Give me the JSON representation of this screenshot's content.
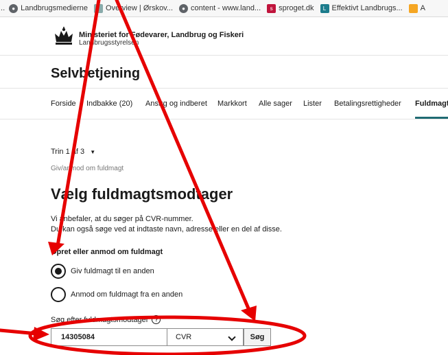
{
  "bookmarks": [
    {
      "label": "Landbrugsmedierne",
      "icon": "globe-icon"
    },
    {
      "label": "Overview | Ørskov...",
      "icon": "photo-icon"
    },
    {
      "label": "content - www.land...",
      "icon": "globe-icon"
    },
    {
      "label": "sproget.dk",
      "icon": "sproget-icon"
    },
    {
      "label": "Effektivt Landbrugs...",
      "icon": "l-icon"
    },
    {
      "label": "A",
      "icon": "chart-icon"
    }
  ],
  "header": {
    "org_name": "Ministeriet for Fødevarer, Landbrug og Fiskeri",
    "org_sub": "Landbrugsstyrelsen",
    "app_title": "Selvbetjening"
  },
  "nav": [
    {
      "label": "Forside"
    },
    {
      "label": "Indbakke (20)"
    },
    {
      "label": "Ansøg og indberet"
    },
    {
      "label": "Markkort"
    },
    {
      "label": "Alle sager"
    },
    {
      "label": "Lister"
    },
    {
      "label": "Betalingsrettigheder"
    },
    {
      "label": "Fuldmagt"
    }
  ],
  "step": "Trin 1 af 3",
  "breadcrumb": "Giv/anmod om fuldmagt",
  "page_title": "Vælg fuldmagtsmodtager",
  "help": {
    "line1": "Vi anbefaler, at du søger på CVR-nummer.",
    "line2": "Du kan også søge ved at indtaste navn, adresse eller en del af disse."
  },
  "radio_group": {
    "label": "Opret eller anmod om fuldmagt",
    "options": [
      {
        "label": "Giv fuldmagt til en anden",
        "checked": true
      },
      {
        "label": "Anmod om fuldmagt fra en anden",
        "checked": false
      }
    ]
  },
  "search": {
    "label": "Søg efter fuldmagtsmodtager",
    "value": "14305084",
    "type_selected": "CVR",
    "button": "Søg"
  },
  "colors": {
    "annotation": "#e60000",
    "nav_active": "#1f6b73"
  }
}
